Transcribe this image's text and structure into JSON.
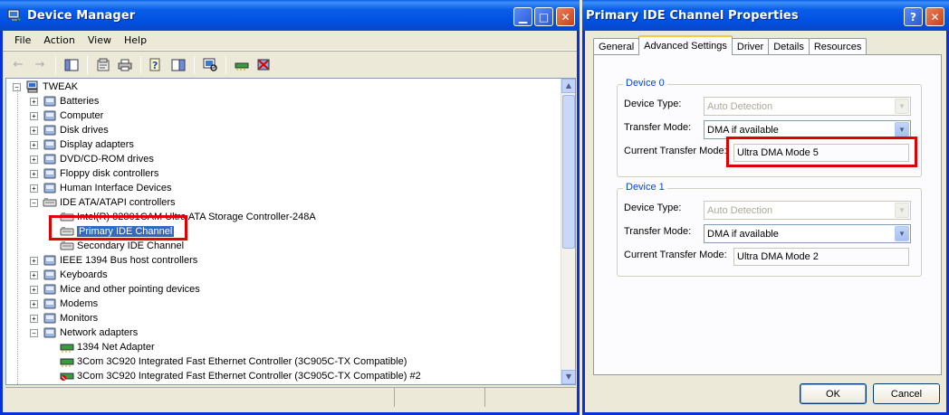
{
  "device_manager": {
    "title": "Device Manager",
    "menu": [
      "File",
      "Action",
      "View",
      "Help"
    ],
    "tree_root": "TWEAK",
    "tree": [
      {
        "label": "Batteries",
        "icon": "battery-icon",
        "level": 1,
        "expander": "+"
      },
      {
        "label": "Computer",
        "icon": "computer-icon",
        "level": 1,
        "expander": "+"
      },
      {
        "label": "Disk drives",
        "icon": "disk-drive-icon",
        "level": 1,
        "expander": "+"
      },
      {
        "label": "Display adapters",
        "icon": "display-adapter-icon",
        "level": 1,
        "expander": "+"
      },
      {
        "label": "DVD/CD-ROM drives",
        "icon": "cdrom-icon",
        "level": 1,
        "expander": "+"
      },
      {
        "label": "Floppy disk controllers",
        "icon": "floppy-controller-icon",
        "level": 1,
        "expander": "+"
      },
      {
        "label": "Human Interface Devices",
        "icon": "hid-icon",
        "level": 1,
        "expander": "+"
      },
      {
        "label": "IDE ATA/ATAPI controllers",
        "icon": "ide-controller-icon",
        "level": 1,
        "expander": "−"
      },
      {
        "label": "Intel(R) 82801CAM Ultra ATA Storage Controller-248A",
        "icon": "ide-controller-icon",
        "level": 2,
        "expander": ""
      },
      {
        "label": "Primary IDE Channel",
        "icon": "ide-controller-icon",
        "level": 2,
        "expander": "",
        "selected": true
      },
      {
        "label": "Secondary IDE Channel",
        "icon": "ide-controller-icon",
        "level": 2,
        "expander": ""
      },
      {
        "label": "IEEE 1394 Bus host controllers",
        "icon": "ieee1394-icon",
        "level": 1,
        "expander": "+"
      },
      {
        "label": "Keyboards",
        "icon": "keyboard-icon",
        "level": 1,
        "expander": "+"
      },
      {
        "label": "Mice and other pointing devices",
        "icon": "mouse-icon",
        "level": 1,
        "expander": "+"
      },
      {
        "label": "Modems",
        "icon": "modem-icon",
        "level": 1,
        "expander": "+"
      },
      {
        "label": "Monitors",
        "icon": "monitor-icon",
        "level": 1,
        "expander": "+"
      },
      {
        "label": "Network adapters",
        "icon": "network-adapter-icon",
        "level": 1,
        "expander": "−"
      },
      {
        "label": "1394 Net Adapter",
        "icon": "network-card-icon",
        "level": 2,
        "expander": ""
      },
      {
        "label": "3Com 3C920 Integrated Fast Ethernet Controller (3C905C-TX Compatible)",
        "icon": "network-card-icon",
        "level": 2,
        "expander": ""
      },
      {
        "label": "3Com 3C920 Integrated Fast Ethernet Controller (3C905C-TX Compatible) #2",
        "icon": "network-card-disabled-icon",
        "level": 2,
        "expander": ""
      }
    ]
  },
  "properties": {
    "title": "Primary IDE Channel Properties",
    "tabs": [
      "General",
      "Advanced Settings",
      "Driver",
      "Details",
      "Resources"
    ],
    "active_tab": "Advanced Settings",
    "device0": {
      "legend": "Device 0",
      "device_type_label": "Device Type:",
      "device_type_value": "Auto Detection",
      "transfer_mode_label": "Transfer Mode:",
      "transfer_mode_value": "DMA if available",
      "current_mode_label": "Current Transfer Mode:",
      "current_mode_value": "Ultra DMA Mode 5"
    },
    "device1": {
      "legend": "Device 1",
      "device_type_label": "Device Type:",
      "device_type_value": "Auto Detection",
      "transfer_mode_label": "Transfer Mode:",
      "transfer_mode_value": "DMA if available",
      "current_mode_label": "Current Transfer Mode:",
      "current_mode_value": "Ultra DMA Mode 2"
    },
    "ok_label": "OK",
    "cancel_label": "Cancel"
  },
  "colors": {
    "titlebar": "#0a5fe8",
    "selection": "#316ac5",
    "highlight_box": "#e00000",
    "group_legend": "#0046d5"
  }
}
